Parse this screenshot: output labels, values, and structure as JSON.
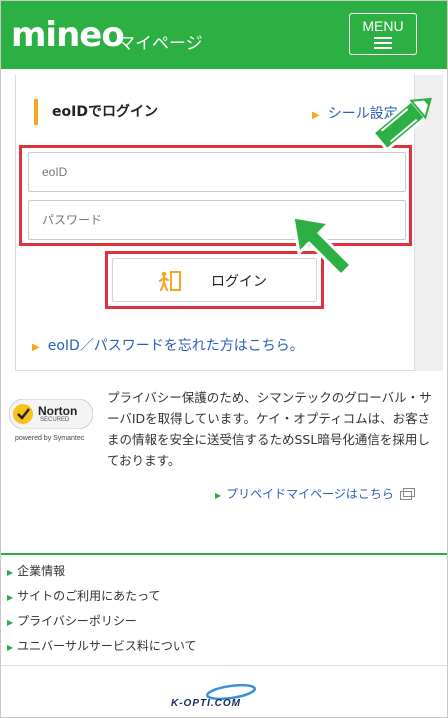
{
  "header": {
    "logo": "mineo",
    "subtitle": "マイページ",
    "menu_label": "MENU"
  },
  "login": {
    "heading": "eoIDでログイン",
    "seal_link": "シール設定",
    "id_placeholder": "eoID",
    "password_placeholder": "パスワード",
    "login_button": "ログイン",
    "forgot_link": "eoID／パスワードを忘れた方はこちら。"
  },
  "norton": {
    "brand": "Norton",
    "secured": "SECURED",
    "powered_by": "powered by Symantec"
  },
  "privacy_text": "プライバシー保護のため、シマンテックのグローバル・サーバIDを取得しています。ケイ・オプティコムは、お客さまの情報を安全に送受信するためSSL暗号化通信を採用しております。",
  "prepaid_link": "プリペイドマイページはこちら",
  "footer": {
    "links": [
      "企業情報",
      "サイトのご利用にあたって",
      "プライバシーポリシー",
      "ユニバーサルサービス料について"
    ],
    "company_logo": "K-OPTI.COM"
  },
  "colors": {
    "brand_green": "#2cb043",
    "highlight_red": "#e0323c",
    "accent_orange": "#f5a623",
    "link_blue": "#2b5fb8"
  },
  "icons": [
    "hamburger-menu-icon",
    "door-exit-icon",
    "pointer-arrow-icon",
    "pencil-icon",
    "external-window-icon"
  ]
}
